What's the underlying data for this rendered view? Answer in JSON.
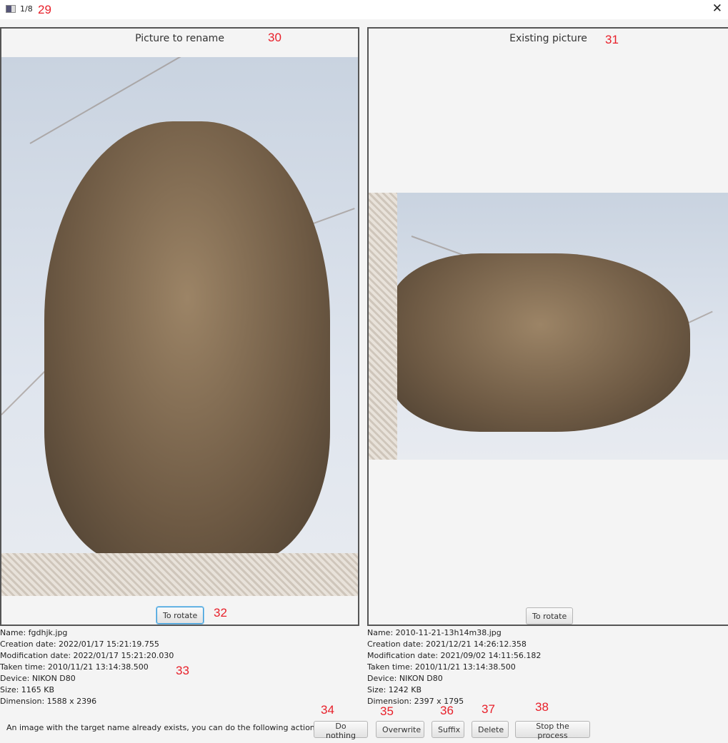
{
  "window": {
    "title": "1/8",
    "icon": "app-window-icon",
    "close_icon": "close-x-icon"
  },
  "left": {
    "title": "Picture to rename",
    "rotate_label": "To rotate",
    "info": [
      "Name: fgdhjk.jpg",
      "Creation date: 2022/01/17 15:21:19.755",
      "Modification date: 2022/01/17 15:21:20.030",
      "Taken time: 2010/11/21 13:14:38.500",
      "Device: NIKON D80",
      "Size: 1165 KB",
      "Dimension: 1588 x 2396"
    ]
  },
  "right": {
    "title": "Existing picture",
    "rotate_label": "To rotate",
    "info": [
      "Name: 2010-11-21-13h14m38.jpg",
      "Creation date: 2021/12/21 14:26:12.358",
      "Modification date: 2021/09/02 14:11:56.182",
      "Taken time: 2010/11/21 13:14:38.500",
      "Device: NIKON D80",
      "Size: 1242 KB",
      "Dimension: 2397 x 1795"
    ]
  },
  "actions": {
    "message": "An image with the target name already exists, you can do the following actions:",
    "do_nothing": "Do nothing",
    "overwrite": "Overwrite",
    "suffix": "Suffix",
    "delete": "Delete",
    "stop": "Stop the process"
  },
  "marks": [
    "29",
    "30",
    "31",
    "32",
    "33",
    "34",
    "35",
    "36",
    "37",
    "38"
  ],
  "colors": {
    "mark": "#e8202a",
    "focus": "#3a9bd8"
  }
}
